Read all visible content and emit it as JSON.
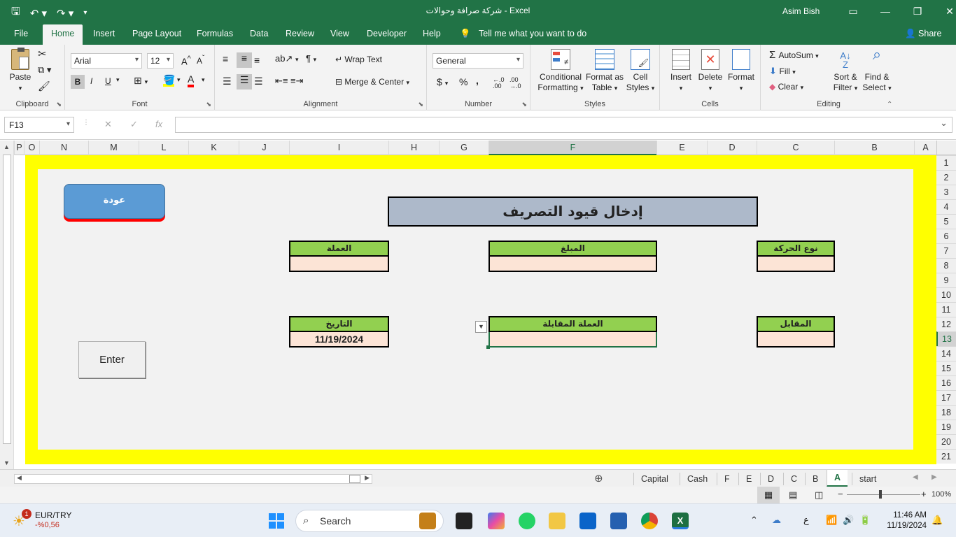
{
  "window": {
    "title": "شركة صرافة وحوالات  -  Excel",
    "user": "Asim Bish"
  },
  "tabs": [
    "File",
    "Home",
    "Insert",
    "Page Layout",
    "Formulas",
    "Data",
    "Review",
    "View",
    "Developer",
    "Help",
    "Tell me what you want to do"
  ],
  "share": "Share",
  "ribbon": {
    "paste": "Paste",
    "clipboard": "Clipboard",
    "font_name": "Arial",
    "font_size": "12",
    "font": "Font",
    "bold": "B",
    "italic": "I",
    "underline": "U",
    "wrap_text": "Wrap Text",
    "merge_center": "Merge & Center",
    "alignment": "Alignment",
    "number_format": "General",
    "currency": "$",
    "percent": "%",
    "comma": ",",
    "number": "Number",
    "conditional_1": "Conditional",
    "conditional_2": "Formatting",
    "format_as_1": "Format as",
    "format_as_2": "Table",
    "cell_styles_1": "Cell",
    "cell_styles_2": "Styles",
    "styles": "Styles",
    "insert": "Insert",
    "delete": "Delete",
    "format": "Format",
    "cells": "Cells",
    "autosum": "AutoSum",
    "fill": "Fill",
    "clear": "Clear",
    "sort_1": "Sort &",
    "sort_2": "Filter",
    "find_1": "Find &",
    "find_2": "Select",
    "editing": "Editing"
  },
  "formula_bar": {
    "name_box": "F13",
    "cancel": "✕",
    "enter": "✓",
    "fx": "fx",
    "value": ""
  },
  "columns": [
    {
      "name": "P",
      "selected": false
    },
    {
      "name": "O",
      "selected": false
    },
    {
      "name": "N",
      "selected": false
    },
    {
      "name": "M",
      "selected": false
    },
    {
      "name": "L",
      "selected": false
    },
    {
      "name": "K",
      "selected": false
    },
    {
      "name": "J",
      "selected": false
    },
    {
      "name": "I",
      "selected": false
    },
    {
      "name": "H",
      "selected": false
    },
    {
      "name": "G",
      "selected": false
    },
    {
      "name": "F",
      "selected": true
    },
    {
      "name": "E",
      "selected": false
    },
    {
      "name": "D",
      "selected": false
    },
    {
      "name": "C",
      "selected": false
    },
    {
      "name": "B",
      "selected": false
    },
    {
      "name": "A",
      "selected": false
    }
  ],
  "rows": [
    "1",
    "2",
    "3",
    "4",
    "5",
    "6",
    "7",
    "8",
    "9",
    "10",
    "11",
    "12",
    "13",
    "14",
    "15",
    "16",
    "17",
    "18",
    "19",
    "20",
    "21"
  ],
  "selected_row": "13",
  "form": {
    "title": "إدخال قيود التصريف",
    "back_button": "عودة",
    "enter_button": "Enter",
    "fields": {
      "currency_label": "العملة",
      "currency_value": "",
      "amount_label": "المبلغ",
      "amount_value": "",
      "movement_type_label": "نوع الحركة",
      "movement_type_value": "",
      "date_label": "التاريخ",
      "date_value": "11/19/2024",
      "counter_currency_label": "العملة المقابلة",
      "counter_currency_value": "",
      "counterpart_label": "المقابل",
      "counterpart_value": ""
    }
  },
  "sheet_tabs": [
    {
      "name": "Capital",
      "active": false
    },
    {
      "name": "Cash",
      "active": false
    },
    {
      "name": "F",
      "active": false
    },
    {
      "name": "E",
      "active": false
    },
    {
      "name": "D",
      "active": false
    },
    {
      "name": "C",
      "active": false
    },
    {
      "name": "B",
      "active": false
    },
    {
      "name": "A",
      "active": true
    },
    {
      "name": "start",
      "active": false
    }
  ],
  "status": {
    "zoom": "100%"
  },
  "taskbar": {
    "ticker_name": "EUR/TRY",
    "ticker_change": "-%0,56",
    "ticker_badge": "1",
    "search": "Search",
    "time": "11:46 AM",
    "date": "11/19/2024",
    "lang": "ع"
  },
  "colors": {
    "excel_green": "#217346",
    "yellow": "#ffff00",
    "label_green": "#92d050",
    "value_peach": "#fce4d6",
    "title_blue": "#adb9ca",
    "back_blue": "#5b9bd5"
  }
}
